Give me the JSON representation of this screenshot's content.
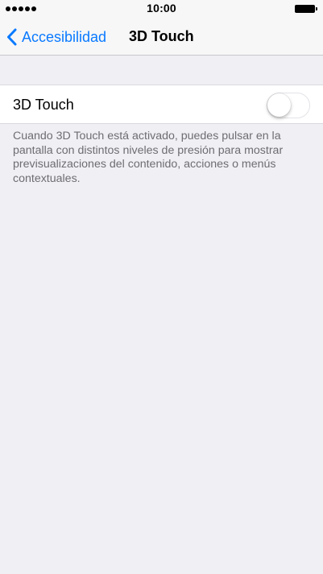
{
  "status_bar": {
    "signal_icon": "signal-dots-icon",
    "time": "10:00",
    "battery_icon": "battery-icon"
  },
  "nav": {
    "back_icon": "chevron-left-icon",
    "back_label": "Accesibilidad",
    "title": "3D Touch"
  },
  "settings": {
    "cell_label": "3D Touch",
    "toggle_on": false,
    "footer": "Cuando 3D Touch está activado, puedes pulsar en la pantalla con distintos niveles de presión para mostrar previsualizaciones del contenido, acciones o menús contextuales."
  },
  "colors": {
    "accent": "#0a7aff",
    "background": "#efeff4",
    "footer_text": "#6d6d72"
  }
}
